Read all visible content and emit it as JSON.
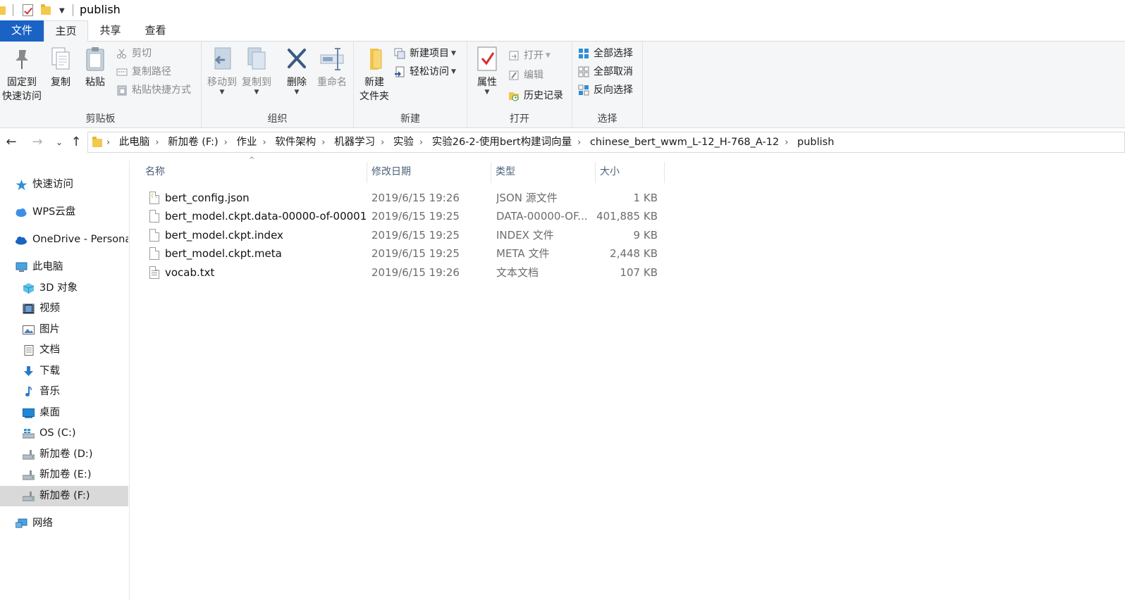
{
  "window": {
    "title": "publish"
  },
  "ribbon_tabs": {
    "file": "文件",
    "home": "主页",
    "share": "共享",
    "view": "查看"
  },
  "clipboard": {
    "pin_line1": "固定到",
    "pin_line2": "快速访问",
    "copy": "复制",
    "paste": "粘贴",
    "cut": "剪切",
    "copy_path": "复制路径",
    "paste_shortcut": "粘贴快捷方式",
    "group_label": "剪贴板"
  },
  "organize": {
    "move_to": "移动到",
    "copy_to": "复制到",
    "delete": "删除",
    "rename": "重命名",
    "group_label": "组织"
  },
  "new": {
    "new_folder_line1": "新建",
    "new_folder_line2": "文件夹",
    "new_item": "新建项目",
    "easy_access": "轻松访问",
    "group_label": "新建"
  },
  "open": {
    "properties": "属性",
    "open": "打开",
    "edit": "编辑",
    "history": "历史记录",
    "group_label": "打开"
  },
  "select": {
    "select_all": "全部选择",
    "select_none": "全部取消",
    "invert": "反向选择",
    "group_label": "选择"
  },
  "breadcrumb": [
    "此电脑",
    "新加卷 (F:)",
    "作业",
    "软件架构",
    "机器学习",
    "实验",
    "实验26-2-使用bert构建词向量",
    "chinese_bert_wwm_L-12_H-768_A-12",
    "publish"
  ],
  "nav_pane": {
    "quick_access": "快速访问",
    "wps": "WPS云盘",
    "onedrive": "OneDrive - Persona",
    "this_pc": "此电脑",
    "objects3d": "3D 对象",
    "videos": "视频",
    "pictures": "图片",
    "documents": "文档",
    "downloads": "下载",
    "music": "音乐",
    "desktop": "桌面",
    "os_c": "OS (C:)",
    "vol_d": "新加卷 (D:)",
    "vol_e": "新加卷 (E:)",
    "vol_f": "新加卷 (F:)",
    "network": "网络"
  },
  "columns": {
    "name": "名称",
    "date": "修改日期",
    "type": "类型",
    "size": "大小"
  },
  "files": [
    {
      "name": "bert_config.json",
      "date": "2019/6/15 19:26",
      "type": "JSON 源文件",
      "size": "1 KB"
    },
    {
      "name": "bert_model.ckpt.data-00000-of-00001",
      "date": "2019/6/15 19:25",
      "type": "DATA-00000-OF...",
      "size": "401,885 KB"
    },
    {
      "name": "bert_model.ckpt.index",
      "date": "2019/6/15 19:25",
      "type": "INDEX 文件",
      "size": "9 KB"
    },
    {
      "name": "bert_model.ckpt.meta",
      "date": "2019/6/15 19:25",
      "type": "META 文件",
      "size": "2,448 KB"
    },
    {
      "name": "vocab.txt",
      "date": "2019/6/15 19:26",
      "type": "文本文档",
      "size": "107 KB"
    }
  ],
  "colors": {
    "file_tab": "#1a62c4",
    "ribbon_bg": "#f5f6f7",
    "selected_nav": "#d9d9d9",
    "header_text": "#4c607a"
  }
}
